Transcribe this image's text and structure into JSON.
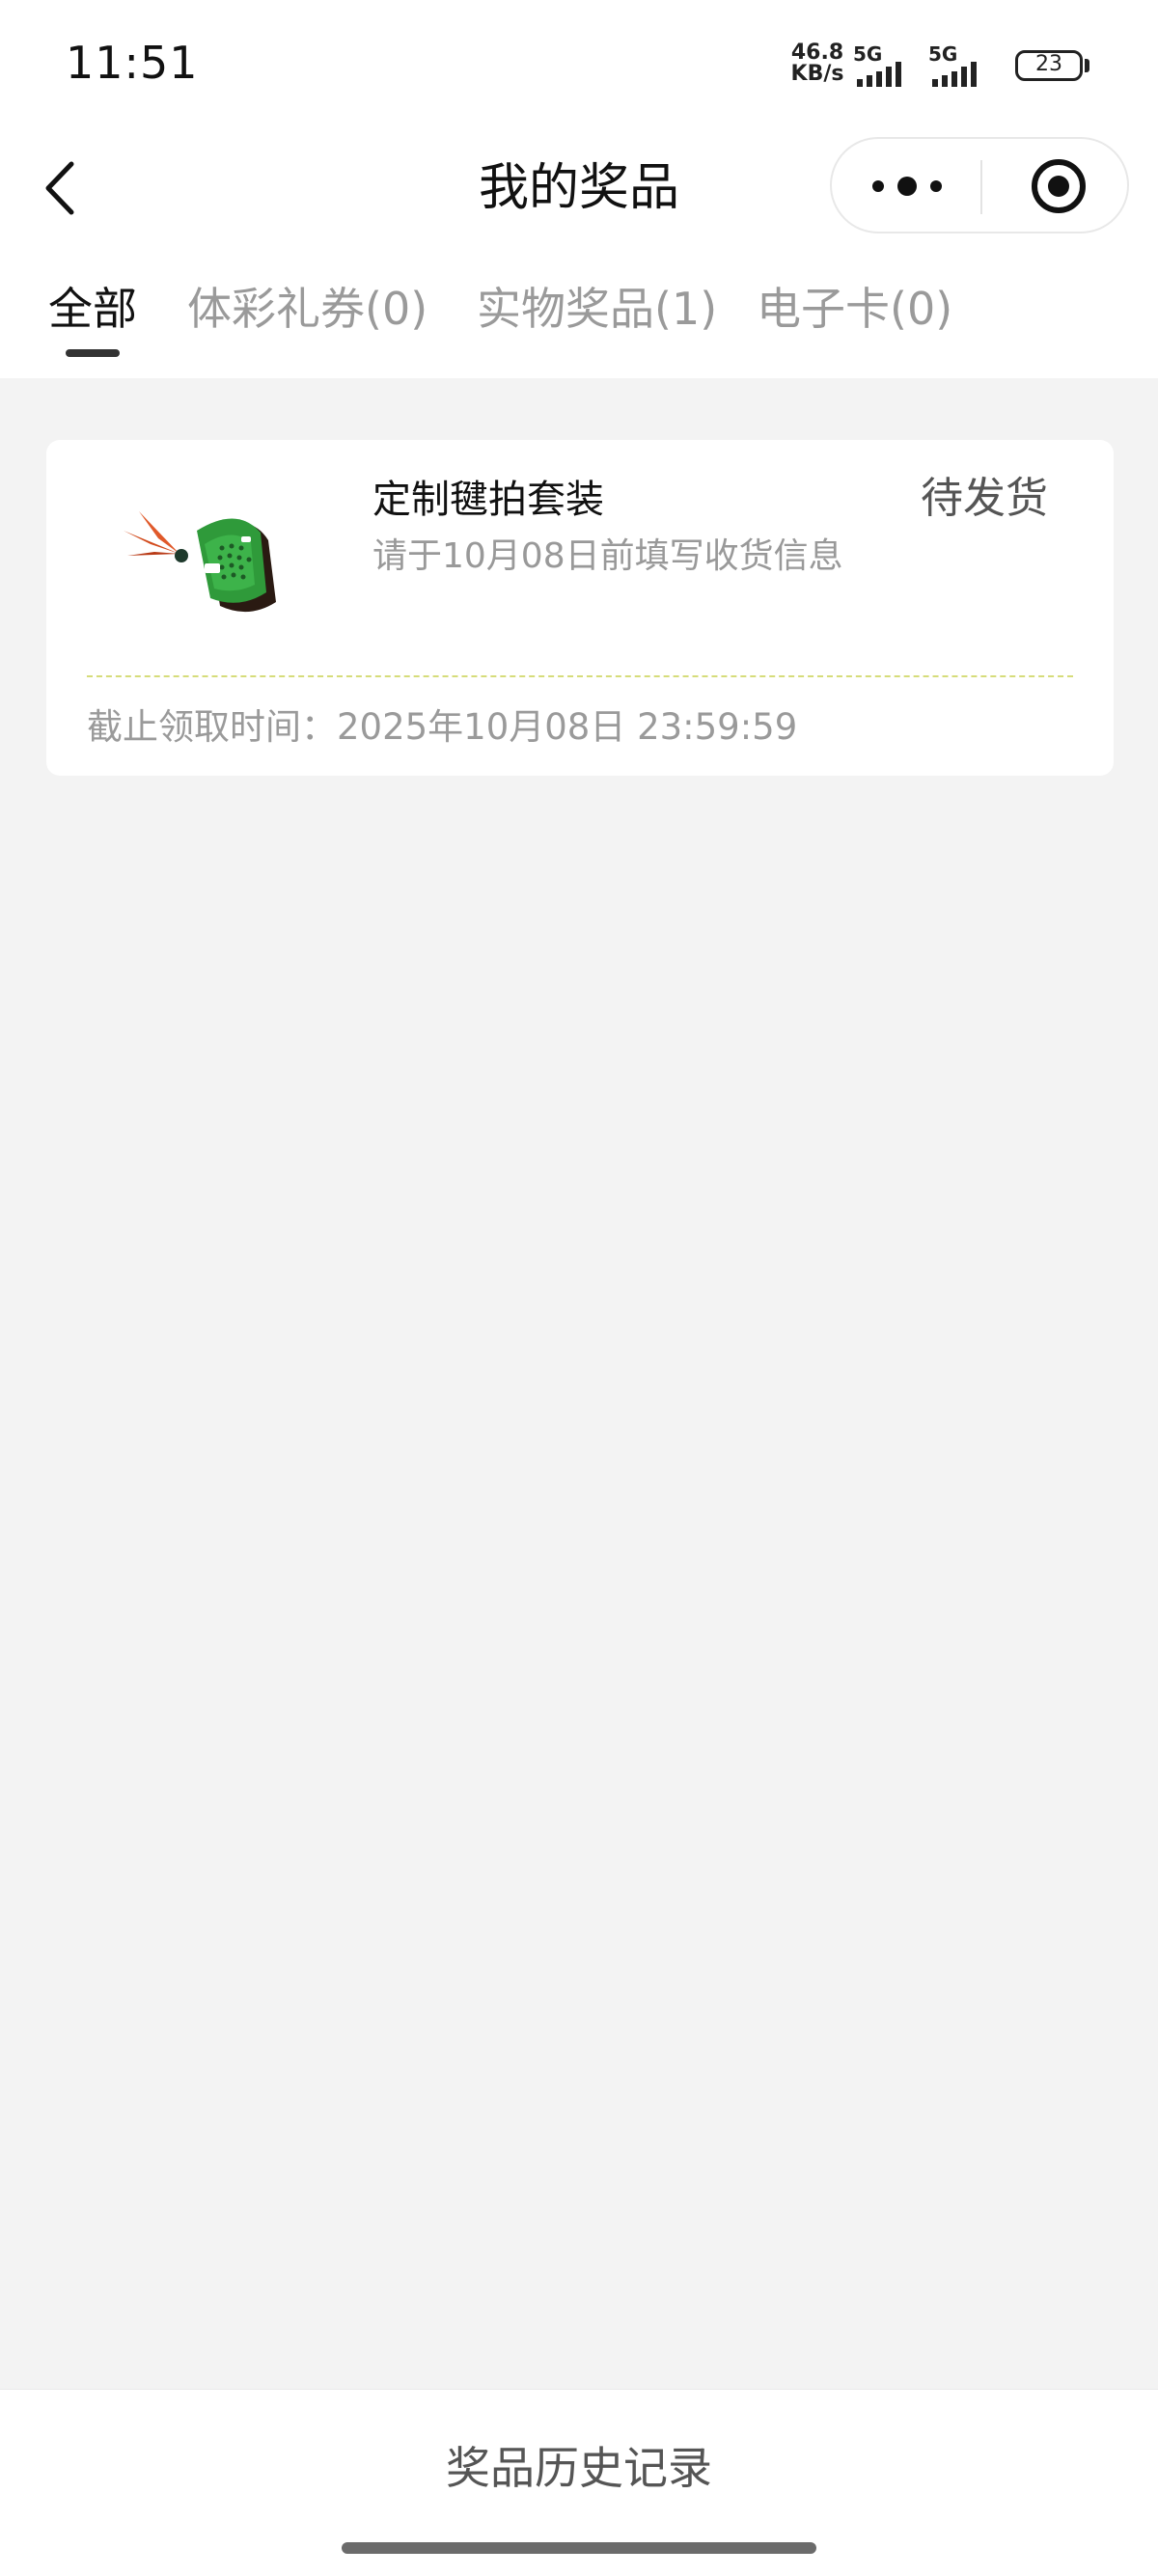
{
  "status_bar": {
    "time": "11:51",
    "net_speed_value": "46.8",
    "net_speed_unit": "KB/s",
    "sim1_label": "5G",
    "sim2_label": "5G",
    "battery_level": "23"
  },
  "nav": {
    "title": "我的奖品",
    "back_icon": "chevron-left-icon",
    "more_icon": "more-dots-icon",
    "close_icon": "target-circle-icon"
  },
  "tabs": [
    {
      "label": "全部",
      "active": true
    },
    {
      "label": "体彩礼券(0)",
      "active": false
    },
    {
      "label": "实物奖品(1)",
      "active": false
    },
    {
      "label": "电子卡(0)",
      "active": false
    }
  ],
  "prizes": [
    {
      "name": "定制毽拍套装",
      "hint": "请于10月08日前填写收货信息",
      "status": "待发货",
      "deadline_label": "截止领取时间：",
      "deadline_value": "2025年10月08日 23:59:59"
    }
  ],
  "bottom": {
    "history_label": "奖品历史记录"
  },
  "colors": {
    "background": "#f3f3f3",
    "card": "#ffffff",
    "divider_dashed": "#d6dc7a",
    "text_primary": "#111111",
    "text_secondary": "#999999"
  }
}
